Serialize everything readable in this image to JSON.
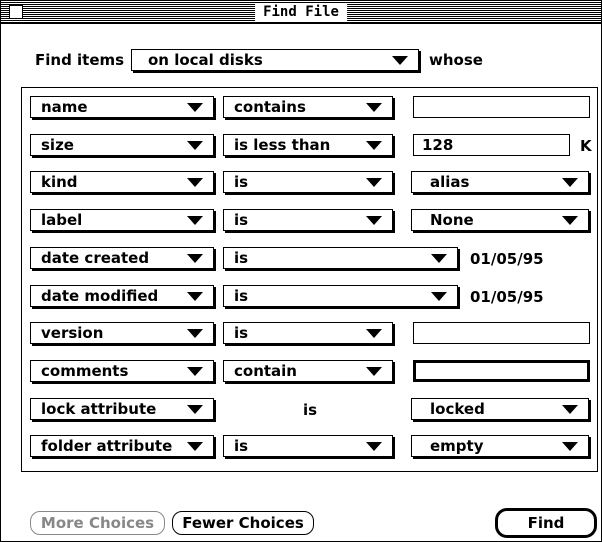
{
  "window": {
    "title": "Find File"
  },
  "scope": {
    "prefix": "Find items",
    "value": "on local disks",
    "suffix": "whose"
  },
  "criteria": [
    {
      "attribute": "name",
      "operator": "contains",
      "value_kind": "text",
      "value": ""
    },
    {
      "attribute": "size",
      "operator": "is less than",
      "value_kind": "text",
      "value": "128",
      "unit": "K"
    },
    {
      "attribute": "kind",
      "operator": "is",
      "value_kind": "popup",
      "value": "alias"
    },
    {
      "attribute": "label",
      "operator": "is",
      "value_kind": "popup",
      "value": "None"
    },
    {
      "attribute": "date created",
      "operator": "is",
      "value_kind": "date",
      "value": "01/05/95"
    },
    {
      "attribute": "date modified",
      "operator": "is",
      "value_kind": "date",
      "value": "01/05/95"
    },
    {
      "attribute": "version",
      "operator": "is",
      "value_kind": "text",
      "value": ""
    },
    {
      "attribute": "comments",
      "operator": "contain",
      "value_kind": "text-active",
      "value": ""
    },
    {
      "attribute": "lock attribute",
      "operator": "is",
      "value_kind": "popup-static-op",
      "value": "locked"
    },
    {
      "attribute": "folder attribute",
      "operator": "is",
      "value_kind": "popup",
      "value": "empty"
    }
  ],
  "buttons": {
    "more": "More Choices",
    "fewer": "Fewer Choices",
    "find": "Find"
  }
}
